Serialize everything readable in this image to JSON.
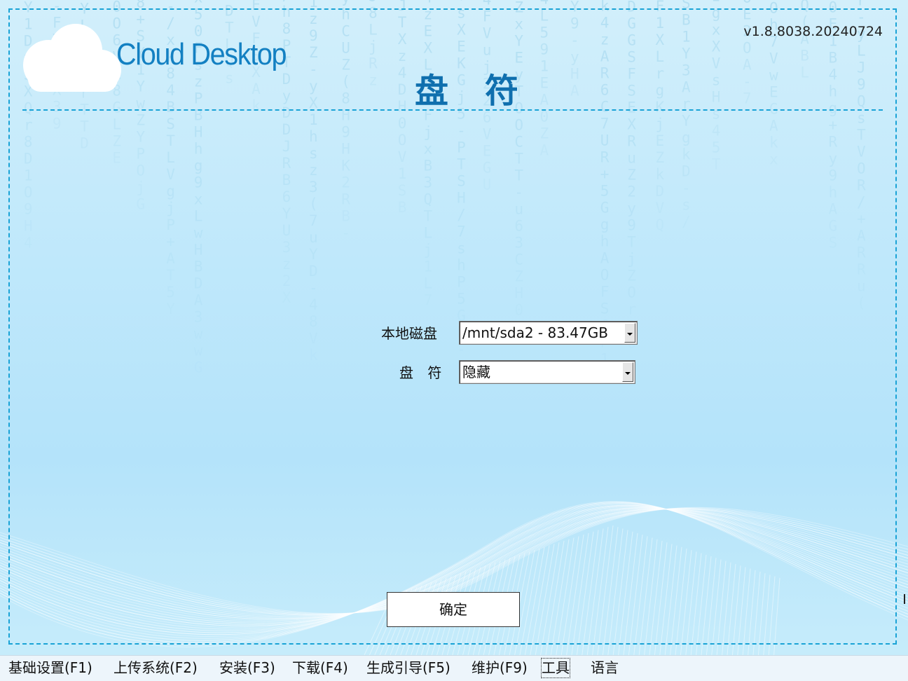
{
  "header": {
    "app_name": "Cloud Desktop",
    "page_title": "盘符",
    "version": "v1.8.8038.20240724"
  },
  "form": {
    "disk_label": "本地磁盘",
    "disk_value": "/mnt/sda2 - 83.47GB",
    "drive_letter_label": "盘 符",
    "drive_letter_value": "隐藏"
  },
  "confirm_label": "确定",
  "menu": [
    {
      "label": "基础设置(F1)"
    },
    {
      "label": "上传系统(F2)"
    },
    {
      "label": "安装(F3)"
    },
    {
      "label": "下载(F4)"
    },
    {
      "label": "生成引导(F5)"
    },
    {
      "label": "维护(F9)"
    },
    {
      "label": "工具",
      "active": true
    },
    {
      "label": "语言"
    }
  ],
  "colors": {
    "accent": "#1380c2",
    "title": "#0f6fae",
    "dashed_border": "#1aa3d6",
    "background": "#bfe8fb"
  },
  "icons": {
    "logo": "cloud-icon",
    "dropdown": "chevron-down-icon"
  }
}
